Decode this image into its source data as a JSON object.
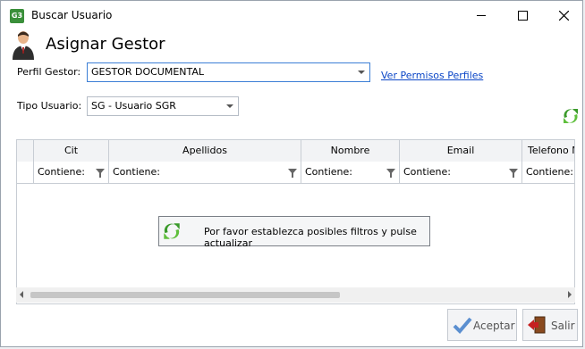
{
  "window": {
    "app_icon_text": "G3",
    "title": "Buscar Usuario",
    "minimize_symbol": "—",
    "maximize_symbol": "☐",
    "close_symbol": "✕"
  },
  "header": {
    "title": "Asignar Gestor",
    "icon": "user-manager-icon"
  },
  "form": {
    "perfil_label": "Perfil Gestor:",
    "perfil_value": "GESTOR DOCUMENTAL",
    "ver_permisos_link": "Ver Permisos Perfiles",
    "tipo_label": "Tipo Usuario:",
    "tipo_value": "SG - Usuario SGR"
  },
  "grid": {
    "columns": [
      "Cit",
      "Apellidos",
      "Nombre",
      "Email",
      "Telefono M"
    ],
    "filter_placeholder": "Contiene:",
    "filters": [
      "Contiene:",
      "Contiene:",
      "Contiene:",
      "Contiene:",
      "Contiene:"
    ]
  },
  "refresh_button": {
    "label": "Por favor establezca posibles filtros y pulse actualizar",
    "icon": "refresh-icon"
  },
  "footer": {
    "accept_label": "Aceptar",
    "exit_label": "Salir"
  },
  "colors": {
    "link": "#0b46c7",
    "accent_green": "#3a9a2a",
    "focus_border": "#3c7fd6"
  }
}
